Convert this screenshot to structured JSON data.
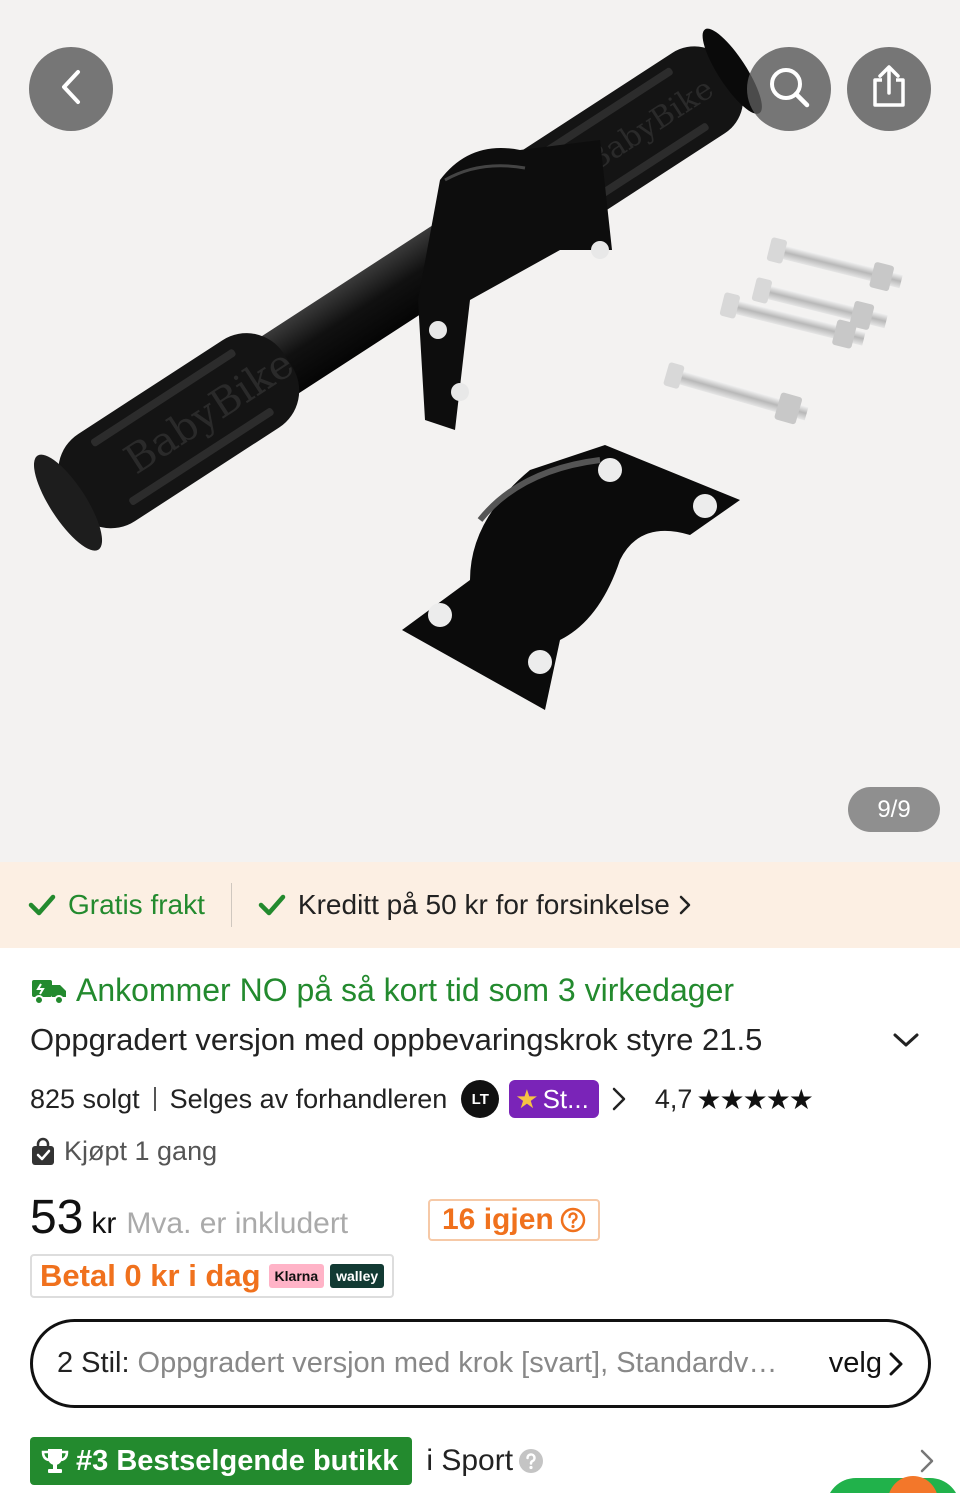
{
  "gallery": {
    "counter": "9/9",
    "image_subject": "BabyBike handlebar with mounting brackets and bolts",
    "grip_brand": "BabyBike"
  },
  "benefits": {
    "free_shipping": "Gratis frakt",
    "credit": "Kreditt på 50 kr for forsinkelse"
  },
  "delivery": {
    "text": "Ankommer NO på så kort tid som 3 virkedager"
  },
  "product": {
    "title": "Oppgradert versjon med oppbevaringskrok styre 21.5"
  },
  "seller": {
    "sold": "825 solgt",
    "sold_by": "Selges av forhandleren",
    "store_logo": "LT",
    "badge": "St...",
    "rating": "4,7",
    "stars": "★★★★★"
  },
  "purchase_history": {
    "text": "Kjøpt 1 gang"
  },
  "price": {
    "amount": "53",
    "currency": "kr",
    "vat_note": "Mva. er inkludert",
    "stock": "16 igjen"
  },
  "pay_later": {
    "text": "Betal 0 kr i dag",
    "providers": [
      "Klarna",
      "walley"
    ]
  },
  "style_selector": {
    "label": "2 Stil:",
    "value": "Oppgradert versjon med krok [svart], Standardversjon [svart]",
    "action": "velg"
  },
  "ranking": {
    "badge": "#3 Bestselgende butikk",
    "category": "i Sport"
  },
  "colors": {
    "accent_green": "#238a2e",
    "accent_orange": "#f0711d",
    "strip_bg": "#fcefe3",
    "store_badge": "#7a24b8"
  },
  "icons": [
    "chevron-left-icon",
    "search-icon",
    "share-icon",
    "check-icon",
    "truck-icon",
    "chevron-down-icon",
    "chevron-right-icon",
    "bag-icon",
    "help-icon",
    "trophy-icon"
  ]
}
